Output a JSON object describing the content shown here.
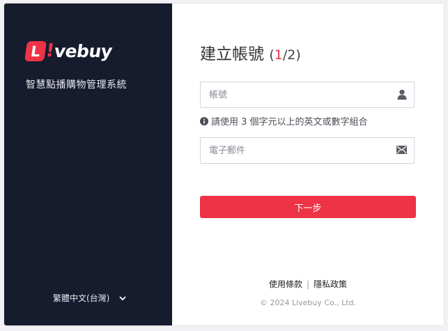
{
  "brand": {
    "logo_letter": "L",
    "logo_bang": "!",
    "logo_text": "vebuy",
    "subtitle": "智慧點播購物管理系統"
  },
  "language": {
    "selected": "繁體中文(台灣)"
  },
  "form": {
    "title": "建立帳號",
    "step_open": "(",
    "step_current": "1",
    "step_total": "/2)",
    "account_placeholder": "帳號",
    "account_value": "",
    "hint": "請使用 3 個字元以上的英文或數字組合",
    "email_placeholder": "電子郵件",
    "email_value": "",
    "next_label": "下一步"
  },
  "footer": {
    "terms": "使用條款",
    "separator": "|",
    "privacy": "隱私政策",
    "copyright": "© 2024 Livebuy Co., Ltd."
  },
  "colors": {
    "accent": "#ef3347",
    "sidebar": "#161b2e"
  },
  "icons": {
    "account_field": "user-icon",
    "email_field": "envelope-icon",
    "hint": "info-circle-icon",
    "language": "chevron-down-icon"
  }
}
